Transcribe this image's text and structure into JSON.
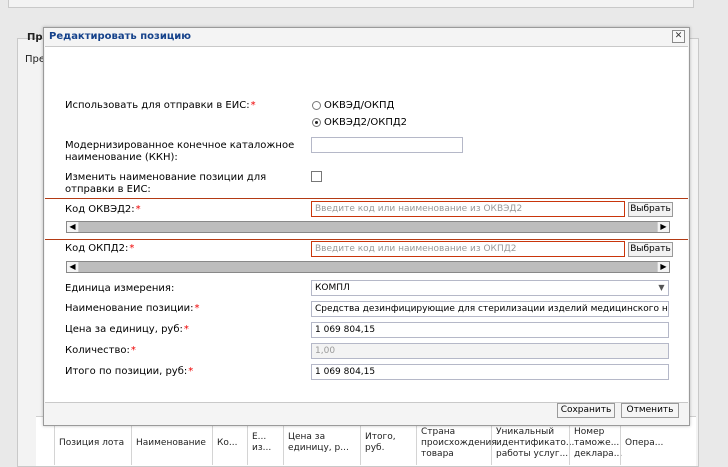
{
  "background": {
    "section_label": "Пр",
    "section_label2": "Пре",
    "grid_headers": [
      "Позиция лота",
      "Наименование",
      "Ко...",
      "Е...\nиз...",
      "Цена за\nединицу, р...",
      "Итого,\nруб.",
      "Страна\nпроисхождения\nтовара",
      "Уникальный\nидентификато...\nработы услуг...",
      "Номер\nтаможе...\nдеклара...",
      "Опера..."
    ]
  },
  "modal": {
    "title": "Редактировать позицию",
    "close_icon": "close-icon",
    "fields": {
      "use_for_eis_label": "Использовать для отправки в ЕИС:",
      "radio_okved_okpd": "ОКВЭД/ОКПД",
      "radio_okved2_okpd2": "ОКВЭД2/ОКПД2",
      "selected_radio": "ОКВЭД2/ОКПД2",
      "kkn_label": "Модернизированное конечное каталожное наименование (ККН):",
      "kkn_value": "",
      "change_name_label": "Изменить наименование позиции для отправки в ЕИС:",
      "okved2_label": "Код ОКВЭД2:",
      "okved2_placeholder": "Введите код или наименование из ОКВЭД2",
      "okpd2_label": "Код ОКПД2:",
      "okpd2_placeholder": "Введите код или наименование из ОКПД2",
      "select_button": "Выбрать",
      "unit_label": "Единица измерения:",
      "unit_value": "КОМПЛ",
      "name_label": "Наименование позиции:",
      "name_value": "Средства дезинфицирующие для стерилизации изделий медицинского н",
      "price_label": "Цена за единицу, руб:",
      "price_value": "1 069 804,15",
      "qty_label": "Количество:",
      "qty_value": "1,00",
      "total_label": "Итого по позиции, руб:",
      "total_value": "1 069 804,15",
      "required_mark": "*"
    },
    "buttons": {
      "save": "Сохранить",
      "cancel": "Отменить"
    }
  },
  "colors": {
    "required": "#ee0000",
    "error_border": "#c9350b",
    "title": "#15428b"
  }
}
